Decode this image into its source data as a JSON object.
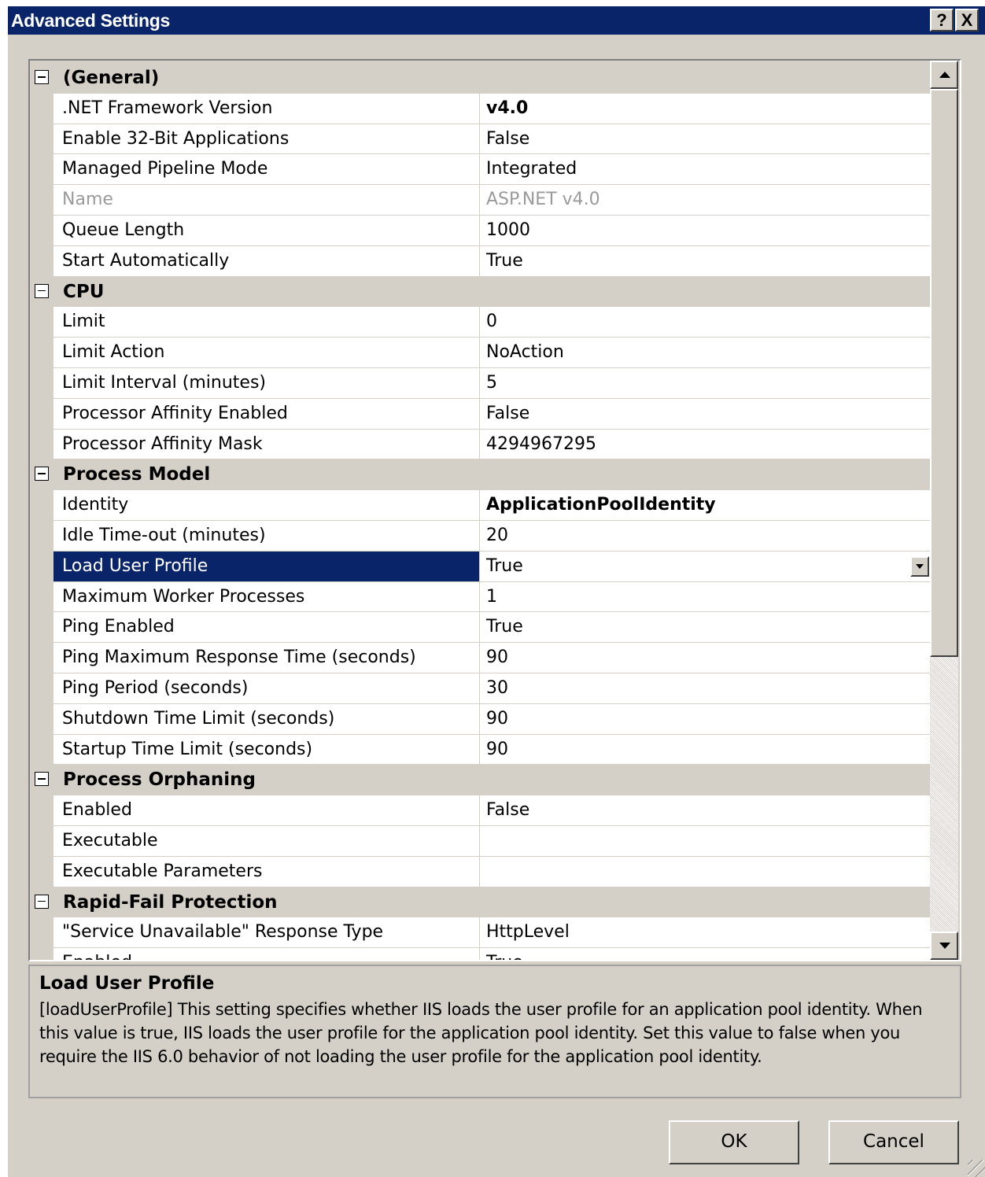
{
  "window": {
    "title": "Advanced Settings",
    "help_label": "?",
    "close_label": "X"
  },
  "grid": {
    "categories": [
      {
        "label": "(General)",
        "properties": [
          {
            "name": ".NET Framework Version",
            "value": "v4.0",
            "bold": true
          },
          {
            "name": "Enable 32-Bit Applications",
            "value": "False"
          },
          {
            "name": "Managed Pipeline Mode",
            "value": "Integrated"
          },
          {
            "name": "Name",
            "value": "ASP.NET v4.0",
            "disabled": true
          },
          {
            "name": "Queue Length",
            "value": "1000"
          },
          {
            "name": "Start Automatically",
            "value": "True"
          }
        ]
      },
      {
        "label": "CPU",
        "properties": [
          {
            "name": "Limit",
            "value": "0"
          },
          {
            "name": "Limit Action",
            "value": "NoAction"
          },
          {
            "name": "Limit Interval (minutes)",
            "value": "5"
          },
          {
            "name": "Processor Affinity Enabled",
            "value": "False"
          },
          {
            "name": "Processor Affinity Mask",
            "value": "4294967295"
          }
        ]
      },
      {
        "label": "Process Model",
        "properties": [
          {
            "name": "Identity",
            "value": "ApplicationPoolIdentity",
            "bold": true
          },
          {
            "name": "Idle Time-out (minutes)",
            "value": "20"
          },
          {
            "name": "Load User Profile",
            "value": "True",
            "selected": true
          },
          {
            "name": "Maximum Worker Processes",
            "value": "1"
          },
          {
            "name": "Ping Enabled",
            "value": "True"
          },
          {
            "name": "Ping Maximum Response Time (seconds)",
            "value": "90"
          },
          {
            "name": "Ping Period (seconds)",
            "value": "30"
          },
          {
            "name": "Shutdown Time Limit (seconds)",
            "value": "90"
          },
          {
            "name": "Startup Time Limit (seconds)",
            "value": "90"
          }
        ]
      },
      {
        "label": "Process Orphaning",
        "properties": [
          {
            "name": "Enabled",
            "value": "False"
          },
          {
            "name": "Executable",
            "value": ""
          },
          {
            "name": "Executable Parameters",
            "value": ""
          }
        ]
      },
      {
        "label": "Rapid-Fail Protection",
        "properties": [
          {
            "name": "\"Service Unavailable\" Response Type",
            "value": "HttpLevel"
          },
          {
            "name": "Enabled",
            "value": "True"
          }
        ]
      }
    ]
  },
  "description": {
    "title": "Load User Profile",
    "text": "[loadUserProfile] This setting specifies whether IIS loads the user profile for an application pool identity. When this value is true, IIS loads the user profile for the application pool identity. Set this value to false when you require the IIS 6.0 behavior of not loading the user profile for the application pool identity."
  },
  "buttons": {
    "ok": "OK",
    "cancel": "Cancel"
  }
}
